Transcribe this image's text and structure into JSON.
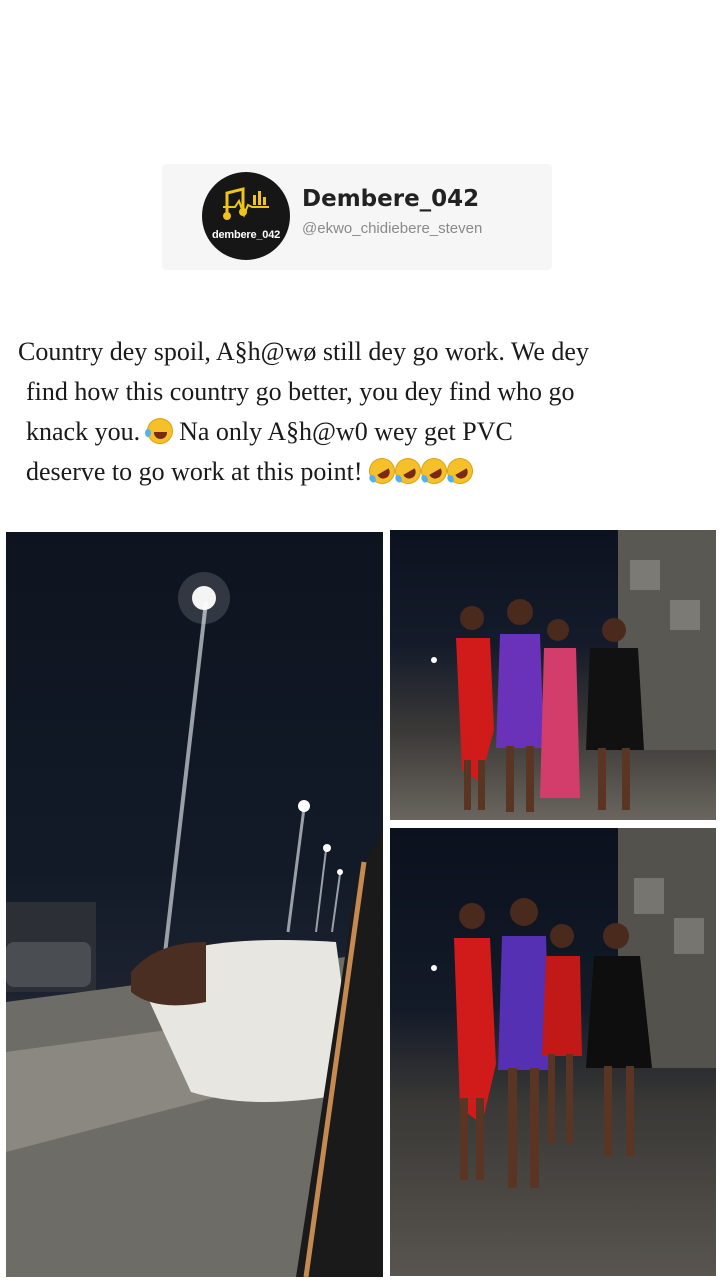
{
  "post": {
    "author_display_name": "Dembere_042",
    "author_handle": "@ekwo_chidiebere_steven",
    "avatar_text": "dembere_042",
    "caption_lines": [
      "Country dey spoil, A§h@wø still dey go work. We dey",
      "find how this country go better, you dey find who go",
      "knack you.",
      "Na only A§h@w0 wey get PVC",
      "deserve to go work at this point!"
    ],
    "caption_emojis": [
      "face-with-tears-of-joy",
      "rolling-on-floor-laughing x4"
    ]
  },
  "photos": [
    {
      "icon": "night-street-lights-photo"
    },
    {
      "icon": "group-of-women-night-photo"
    },
    {
      "icon": "group-of-women-night-photo-2"
    }
  ],
  "colors": {
    "avatar_bg": "#161616",
    "avatar_accent": "#f0c419",
    "card_bg": "#f6f6f6",
    "text": "#1a1a1a",
    "handle": "#8a8a8a"
  }
}
